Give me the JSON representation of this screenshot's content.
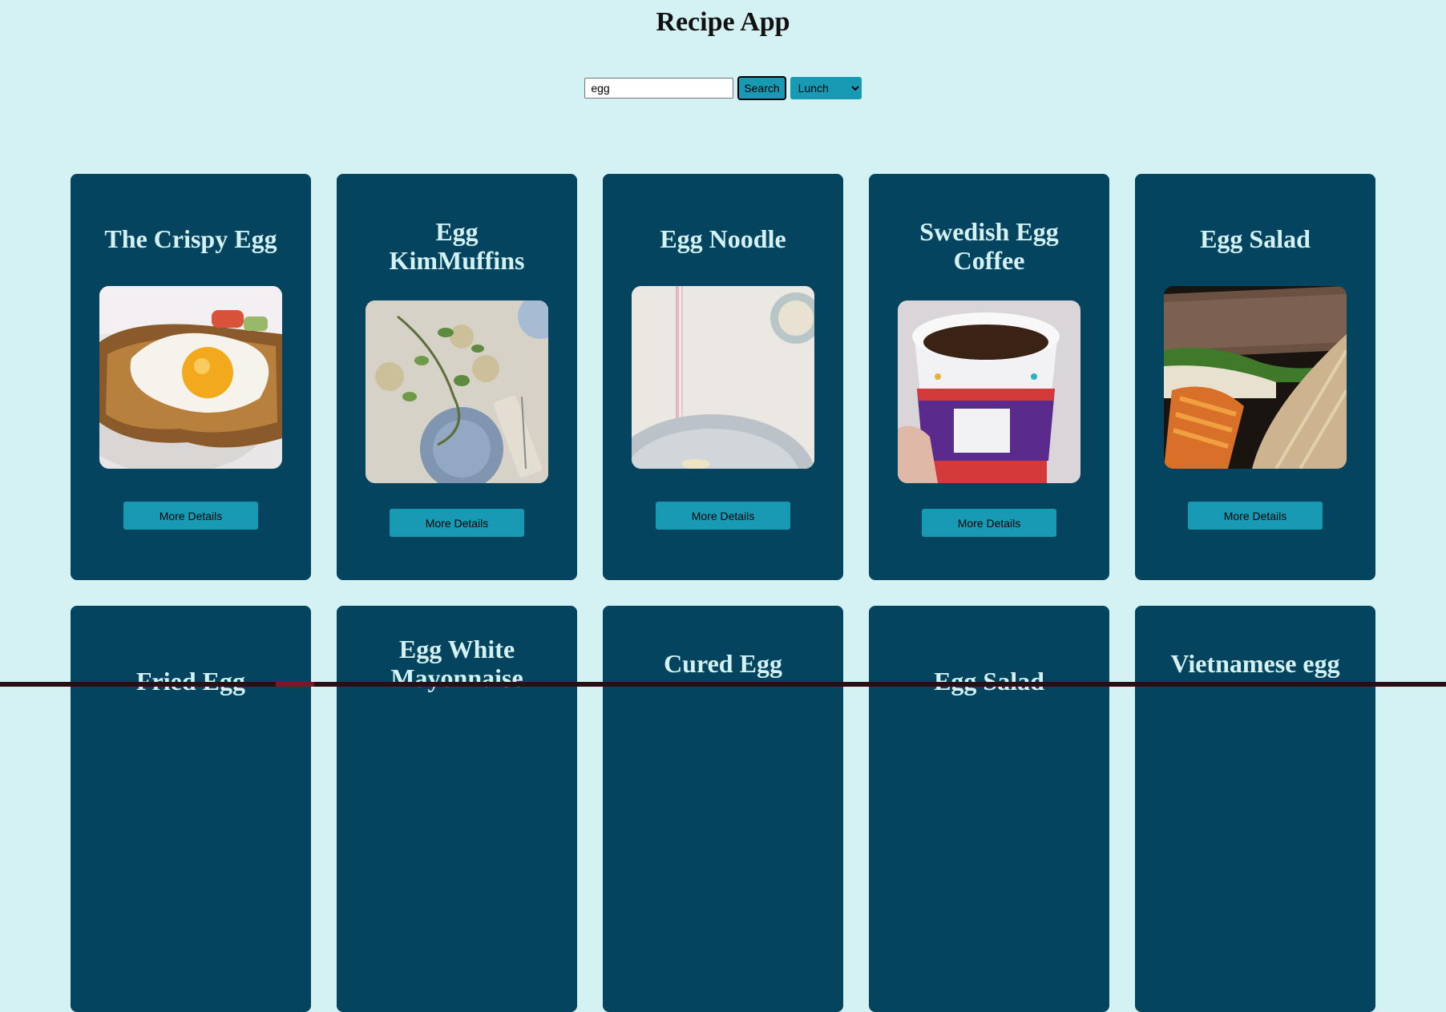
{
  "app": {
    "title": "Recipe App"
  },
  "search": {
    "value": "egg",
    "button_label": "Search",
    "meal_selected": "Lunch"
  },
  "card_button_label": "More Details",
  "cards": [
    {
      "title": "The Crispy Egg",
      "image": "fried-egg-on-toast"
    },
    {
      "title": "Egg KimMuffins",
      "image": "table-setting-with-plates"
    },
    {
      "title": "Egg Noodle",
      "image": "linen-with-plate"
    },
    {
      "title": "Swedish Egg Coffee",
      "image": "coffee-cup"
    },
    {
      "title": "Egg Salad",
      "image": "sandwich"
    },
    {
      "title": "Fried Egg"
    },
    {
      "title": "Egg White Mayonnaise"
    },
    {
      "title": "Cured Egg"
    },
    {
      "title": "Egg Salad"
    },
    {
      "title": "Vietnamese egg"
    }
  ],
  "colors": {
    "background": "#d4f1f4",
    "card": "#05445e",
    "accent": "#189ab4",
    "card_title": "#d4f1f4"
  }
}
